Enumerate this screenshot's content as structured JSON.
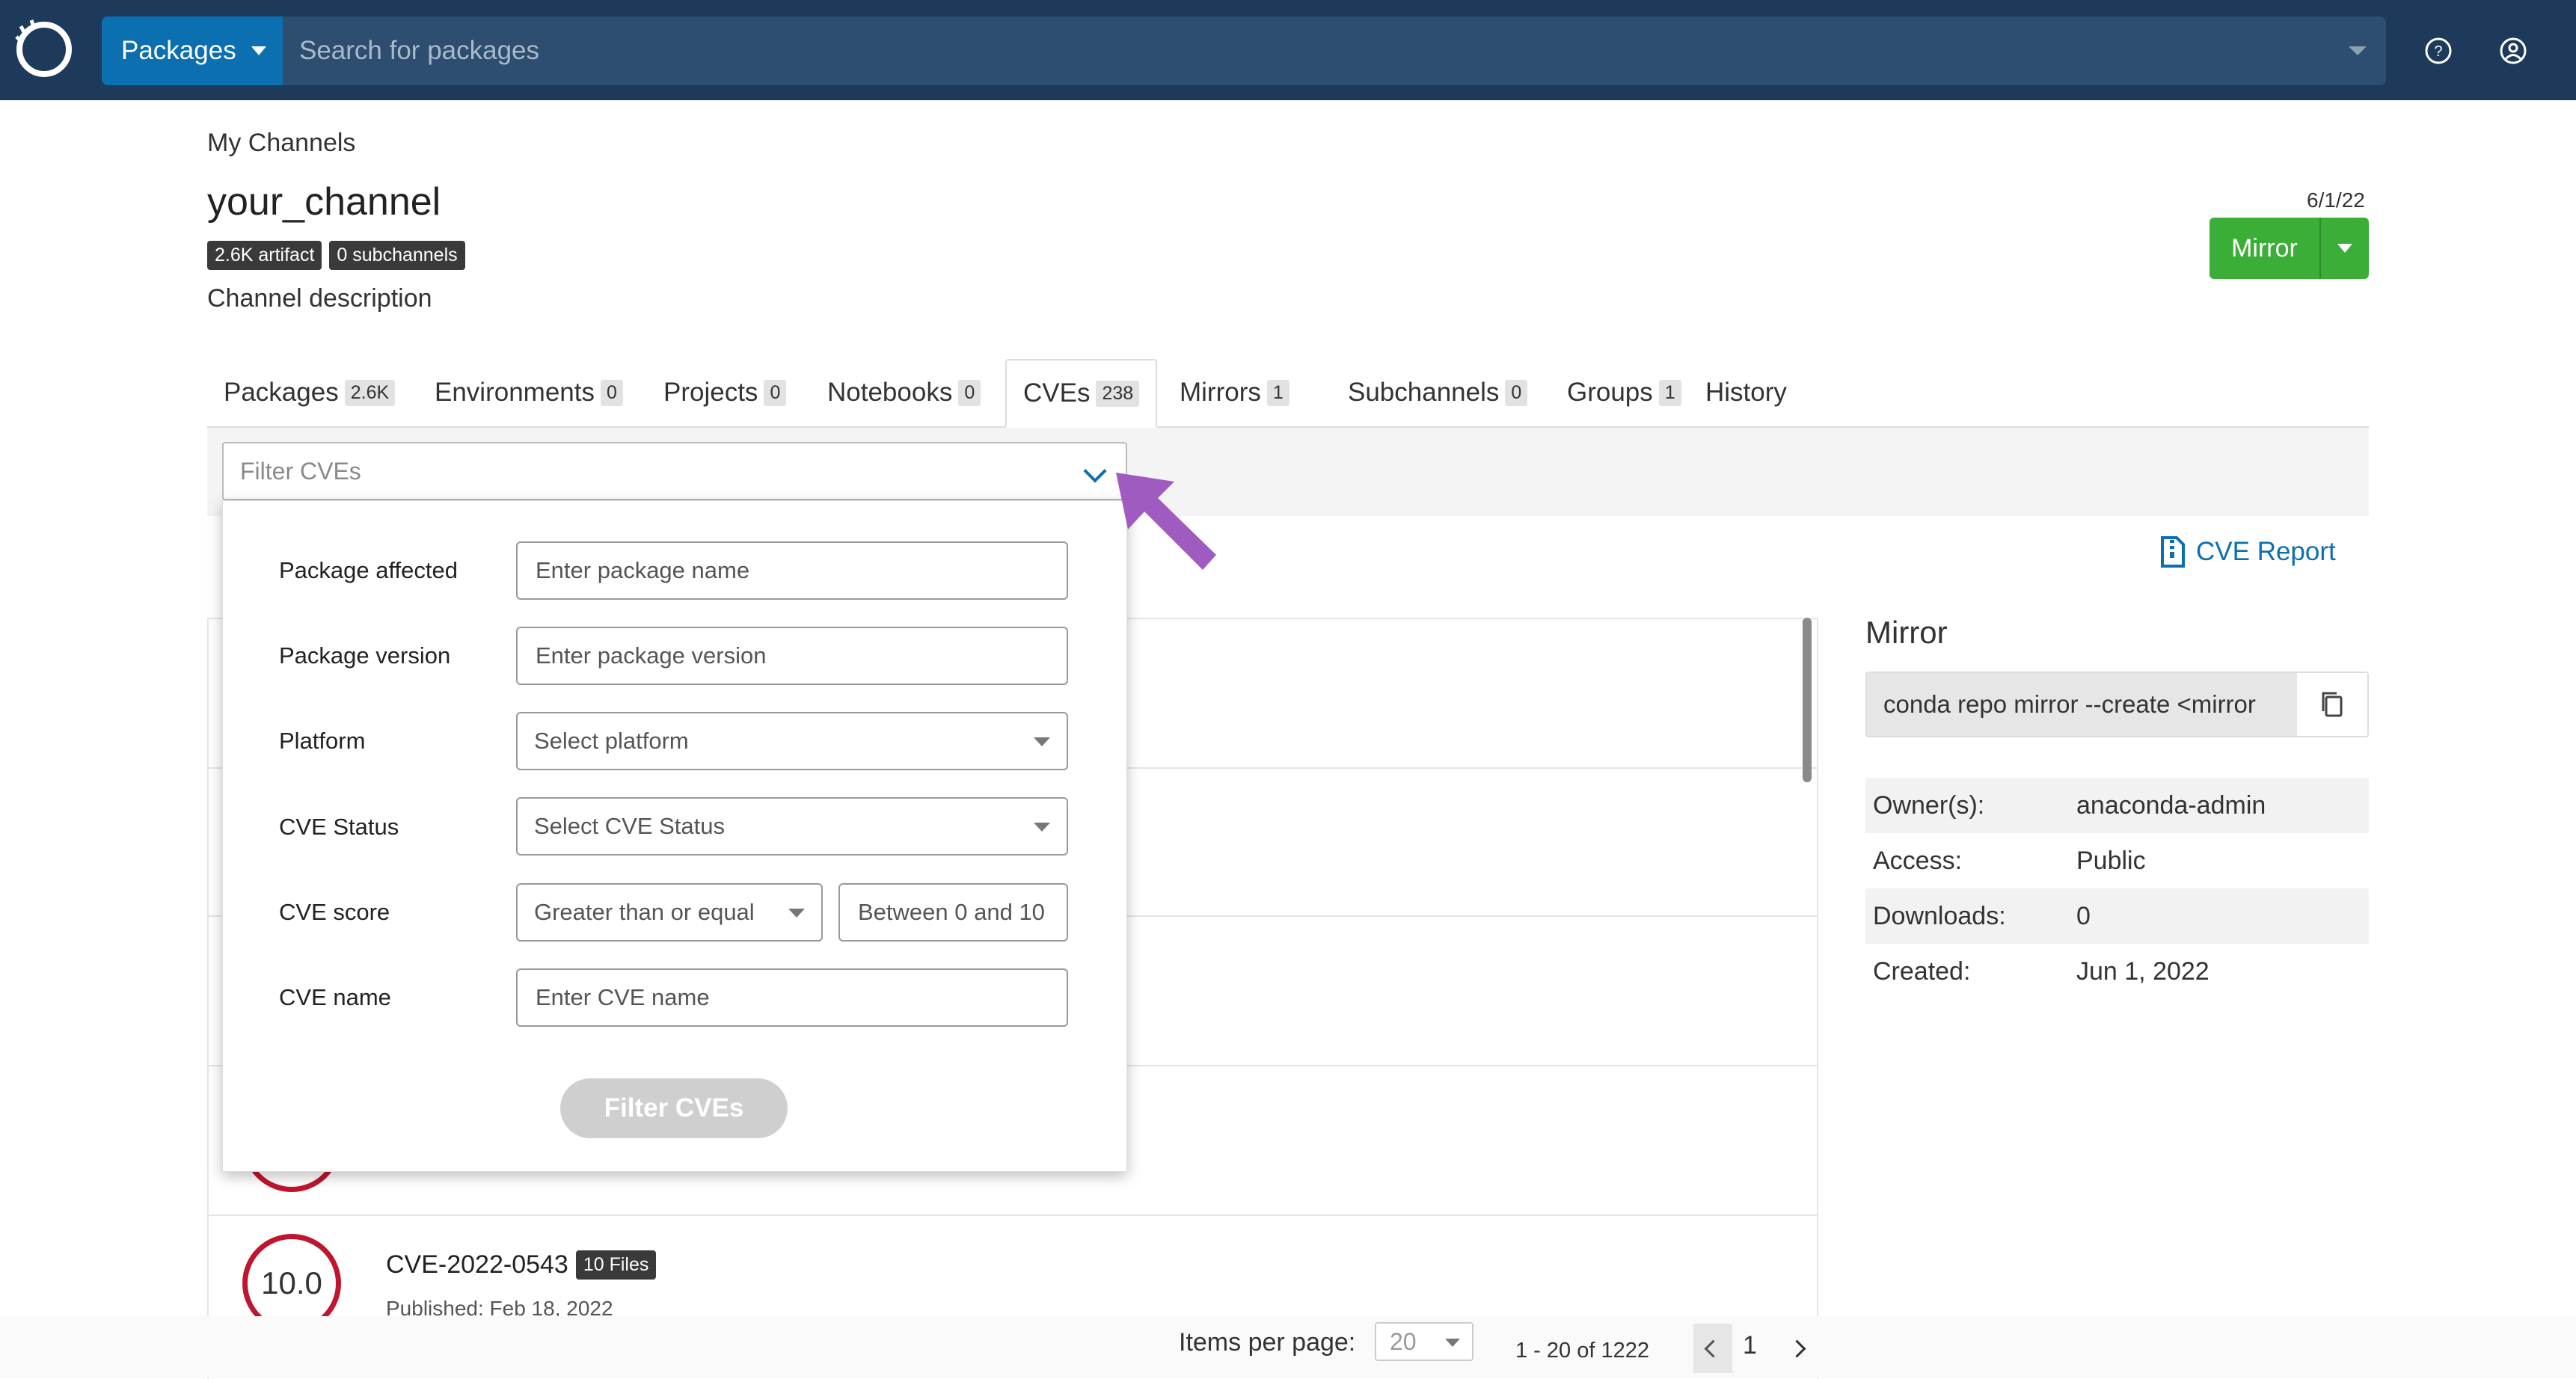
{
  "navbar": {
    "packages_label": "Packages",
    "search_placeholder": "Search for packages"
  },
  "header": {
    "breadcrumb": "My Channels",
    "channel_name": "your_channel",
    "badge_artifact": "2.6K artifact",
    "badge_subchannels": "0 subchannels",
    "description": "Channel description",
    "date": "6/1/22",
    "mirror_button": "Mirror"
  },
  "tabs": [
    {
      "label": "Packages",
      "count": "2.6K"
    },
    {
      "label": "Environments",
      "count": "0"
    },
    {
      "label": "Projects",
      "count": "0"
    },
    {
      "label": "Notebooks",
      "count": "0"
    },
    {
      "label": "CVEs",
      "count": "238"
    },
    {
      "label": "Mirrors",
      "count": "1"
    },
    {
      "label": "Subchannels",
      "count": "0"
    },
    {
      "label": "Groups",
      "count": "1"
    },
    {
      "label": "History",
      "count": ""
    }
  ],
  "filter": {
    "select_placeholder": "Filter CVEs",
    "package_affected_label": "Package affected",
    "package_affected_placeholder": "Enter package name",
    "package_version_label": "Package version",
    "package_version_placeholder": "Enter package version",
    "platform_label": "Platform",
    "platform_value": "Select platform",
    "cve_status_label": "CVE Status",
    "cve_status_value": "Select CVE Status",
    "cve_score_label": "CVE score",
    "cve_score_operator": "Greater than or equal",
    "cve_score_placeholder": "Between 0 and 10",
    "cve_name_label": "CVE name",
    "cve_name_placeholder": "Enter CVE name",
    "submit_label": "Filter CVEs"
  },
  "cve_report_label": "CVE Report",
  "cve_list": [
    {
      "score": "10.0",
      "name": "CVE-2022-0543",
      "files": "10 Files",
      "published": "Published: Feb 18, 2022"
    }
  ],
  "mirror_panel": {
    "title": "Mirror",
    "command": "conda repo mirror --create <mirror",
    "owner_label": "Owner(s):",
    "owner_value": "anaconda-admin",
    "access_label": "Access:",
    "access_value": "Public",
    "downloads_label": "Downloads:",
    "downloads_value": "0",
    "created_label": "Created:",
    "created_value": "Jun 1, 2022"
  },
  "pagination": {
    "items_per_page_label": "Items per page:",
    "items_per_page_value": "20",
    "range": "1 - 20 of 1222",
    "current_page": "1"
  },
  "colors": {
    "navbar": "#1d3a5a",
    "accent_blue": "#0b6fb0",
    "mirror_green": "#3aae37",
    "score_red": "#c0152f",
    "pointer_purple": "#a05bc0"
  }
}
